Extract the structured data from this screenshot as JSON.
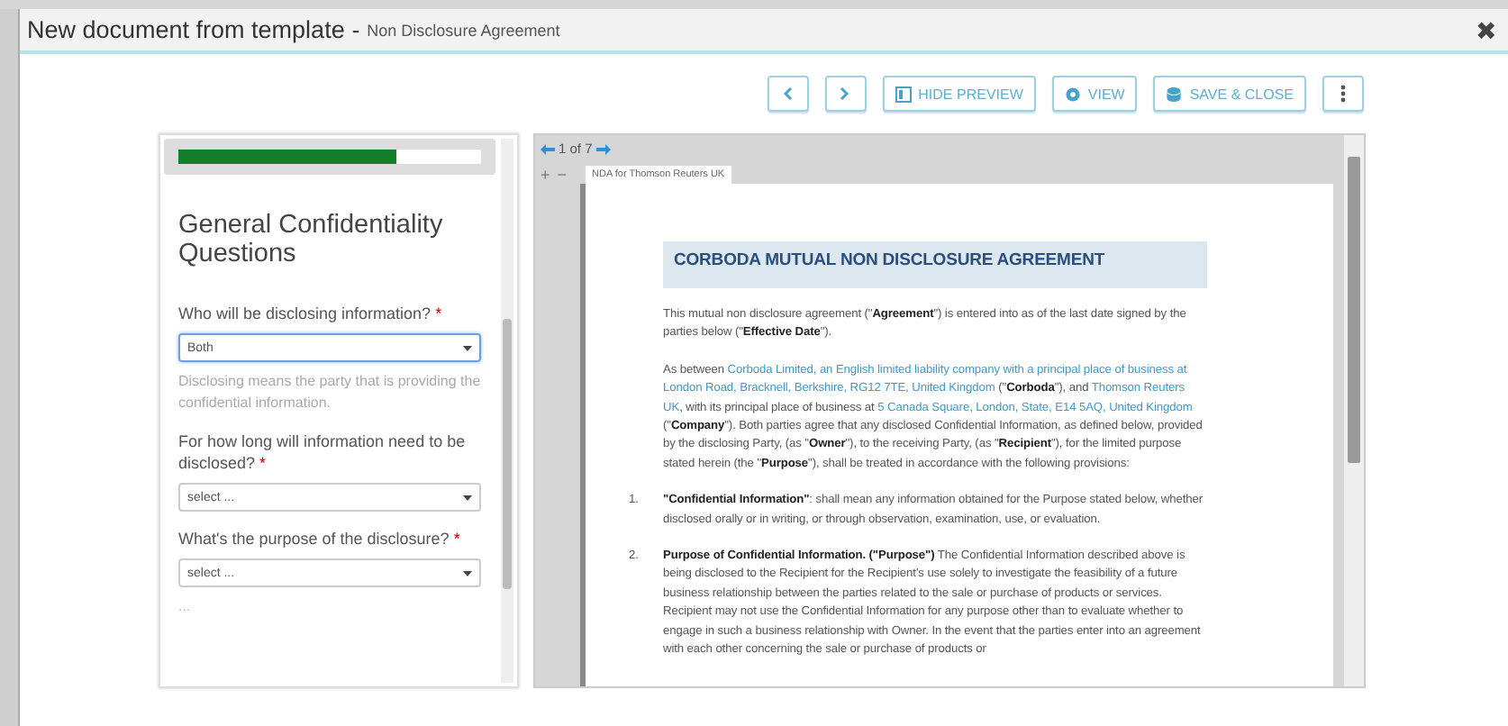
{
  "window": {
    "title": "New document from template",
    "separator": "-",
    "subtitle": "Non Disclosure Agreement",
    "close": "✖"
  },
  "toolbar": {
    "buttons": [
      {
        "kind": "prev"
      },
      {
        "kind": "next"
      },
      {
        "kind": "hide-preview",
        "label": "HIDE PREVIEW"
      },
      {
        "kind": "view",
        "label": "VIEW"
      },
      {
        "kind": "save-close",
        "label": "SAVE & CLOSE"
      },
      {
        "kind": "more"
      }
    ]
  },
  "form": {
    "progress": {
      "level": 0.72
    },
    "title": "General Confidentiality Questions",
    "questions": [
      {
        "label": "Who will be disclosing information?",
        "required": "*",
        "value": "Both",
        "focused": true,
        "help": "Disclosing means the party that is providing the confidential information."
      },
      {
        "label": "For how long will information need to be disclosed?",
        "required": "*",
        "value": "select ...",
        "focused": false
      },
      {
        "label": "What's the purpose of the disclosure?",
        "required": "*",
        "value": "select ...",
        "focused": false
      }
    ],
    "more": "..."
  },
  "preview": {
    "page_label": "1 of 7",
    "zoom_in": "+",
    "zoom_out": "−",
    "tab": "NDA for Thomson Reuters UK",
    "document": {
      "heading": "CORBODA MUTUAL NON DISCLOSURE AGREEMENT",
      "paragraphs": [
        {
          "kind": "plain",
          "segments": [
            {
              "text": "This mutual non disclosure agreement (\"**Agreement**\") is entered into as of the last date signed by the parties below (\"**Effective Date**\").",
              "field": false
            }
          ]
        },
        {
          "kind": "plain",
          "segments": [
            {
              "text": "As between ",
              "field": false
            },
            {
              "text": "Corboda Limited, an English limited liability company with a principal place of business at London Road, Bracknell, Berkshire, RG12 7TE, United Kingdom",
              "field": true
            },
            {
              "text": " (\"**Corboda**\"), and ",
              "field": false
            },
            {
              "text": "Thomson Reuters UK",
              "field": true
            },
            {
              "text": ", with its principal place of business at ",
              "field": false
            },
            {
              "text": "5 Canada Square, London, State, E14 5AQ, United Kingdom",
              "field": true
            },
            {
              "text": " (\"**Company**\"). Both parties agree that any disclosed Confidential Information, as defined below, provided by the disclosing Party, (as \"**Owner**\"), to the receiving Party, (as \"**Recipient**\"), for the limited purpose stated herein (the \"**Purpose**\"), shall be treated in accordance with the following provisions:",
              "field": false
            }
          ]
        },
        {
          "kind": "numbered",
          "number": "1.",
          "segments": [
            {
              "text": "**\"Confidential Information\"**: shall mean any information obtained for the Purpose stated below, whether disclosed orally or in writing, or through observation, examination, use, or evaluation.",
              "field": false
            }
          ]
        },
        {
          "kind": "numbered",
          "number": "2.",
          "segments": [
            {
              "text": "**Purpose of Confidential Information. (\"Purpose\")** The Confidential Information described above is being disclosed to the Recipient for the Recipient's use solely to investigate the feasibility of a future business relationship between the parties related to the sale or purchase of products or services. Recipient may not use the Confidential Information for any purpose other than to evaluate whether to engage in such a business relationship with Owner. In the event that the parties enter into an agreement with each other concerning the sale or purchase of products or",
              "field": false
            }
          ]
        }
      ]
    }
  }
}
